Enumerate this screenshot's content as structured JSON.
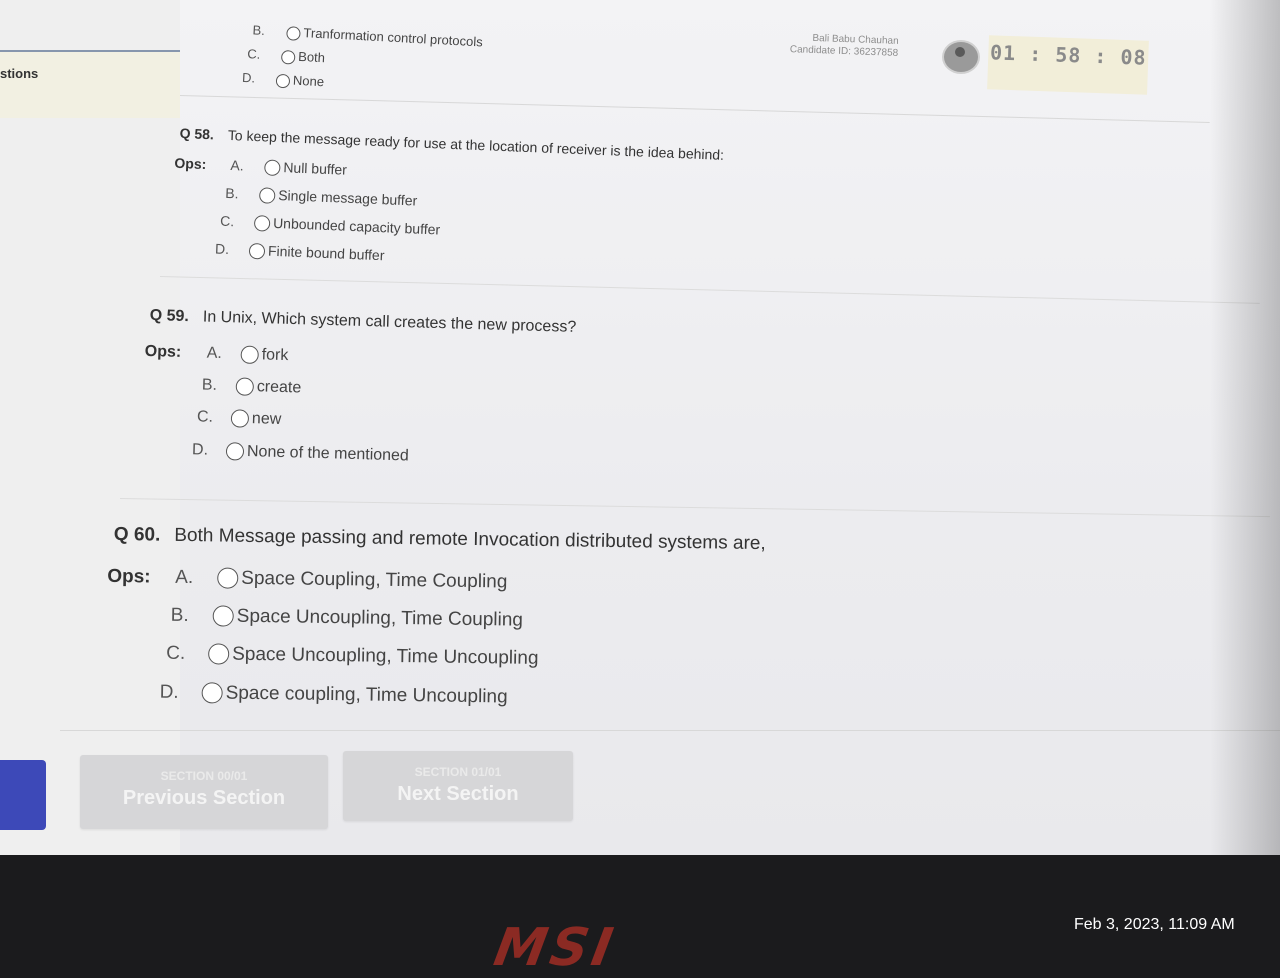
{
  "sidebar": {
    "title": "stions"
  },
  "header": {
    "candidate_name": "Bali Babu Chauhan",
    "candidate_id": "Candidate ID: 36237858",
    "timer": {
      "hours": "01",
      "minutes": "58",
      "seconds": "08",
      "sep": ":"
    }
  },
  "questions": [
    {
      "number": "",
      "text": "",
      "ops_label": "",
      "options": [
        {
          "letter": "B.",
          "text": "Tranformation control protocols"
        },
        {
          "letter": "C.",
          "text": "Both"
        },
        {
          "letter": "D.",
          "text": "None"
        }
      ]
    },
    {
      "number": "Q 58.",
      "text": "To keep the message ready for use at the location of receiver is the idea behind:",
      "ops_label": "Ops:",
      "options": [
        {
          "letter": "A.",
          "text": "Null buffer"
        },
        {
          "letter": "B.",
          "text": "Single message buffer"
        },
        {
          "letter": "C.",
          "text": "Unbounded capacity buffer"
        },
        {
          "letter": "D.",
          "text": "Finite bound buffer"
        }
      ]
    },
    {
      "number": "Q 59.",
      "text": "In Unix, Which system call creates the new process?",
      "ops_label": "Ops:",
      "options": [
        {
          "letter": "A.",
          "text": "fork"
        },
        {
          "letter": "B.",
          "text": "create"
        },
        {
          "letter": "C.",
          "text": "new"
        },
        {
          "letter": "D.",
          "text": "None of the mentioned"
        }
      ]
    },
    {
      "number": "Q 60.",
      "text": "Both Message passing and remote Invocation distributed systems are,",
      "ops_label": "Ops:",
      "options": [
        {
          "letter": "A.",
          "text": "Space Coupling, Time Coupling"
        },
        {
          "letter": "B.",
          "text": "Space Uncoupling, Time Coupling"
        },
        {
          "letter": "C.",
          "text": "Space Uncoupling, Time Uncoupling"
        },
        {
          "letter": "D.",
          "text": "Space coupling, Time Uncoupling"
        }
      ]
    }
  ],
  "footer": {
    "prev": {
      "section": "SECTION 00/01",
      "label": "Previous Section"
    },
    "next": {
      "section": "SECTION 01/01",
      "label": "Next Section"
    }
  },
  "device": {
    "brand": "MSI"
  },
  "photo_timestamp": "Feb 3, 2023, 11:09 AM"
}
